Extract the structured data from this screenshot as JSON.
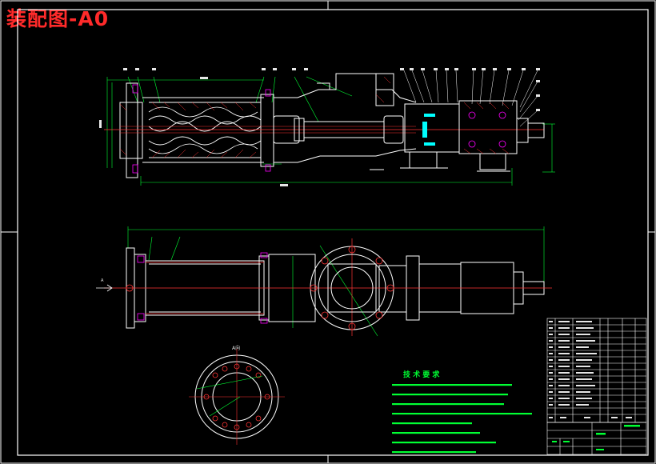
{
  "drawing": {
    "title": "装配图-A0",
    "section_label": "A向",
    "view_marker": "A",
    "technical_requirements_title": "技 术 要 求",
    "colors": {
      "background": "#000000",
      "frame": "#ffffff",
      "outline": "#ffffff",
      "dimension": "#00ff33",
      "hatch": "#ff3333",
      "centerline": "#ff3333",
      "fastener": "#ff00ff",
      "seal": "#00ffff",
      "title_text": "#ff2a2a"
    }
  }
}
